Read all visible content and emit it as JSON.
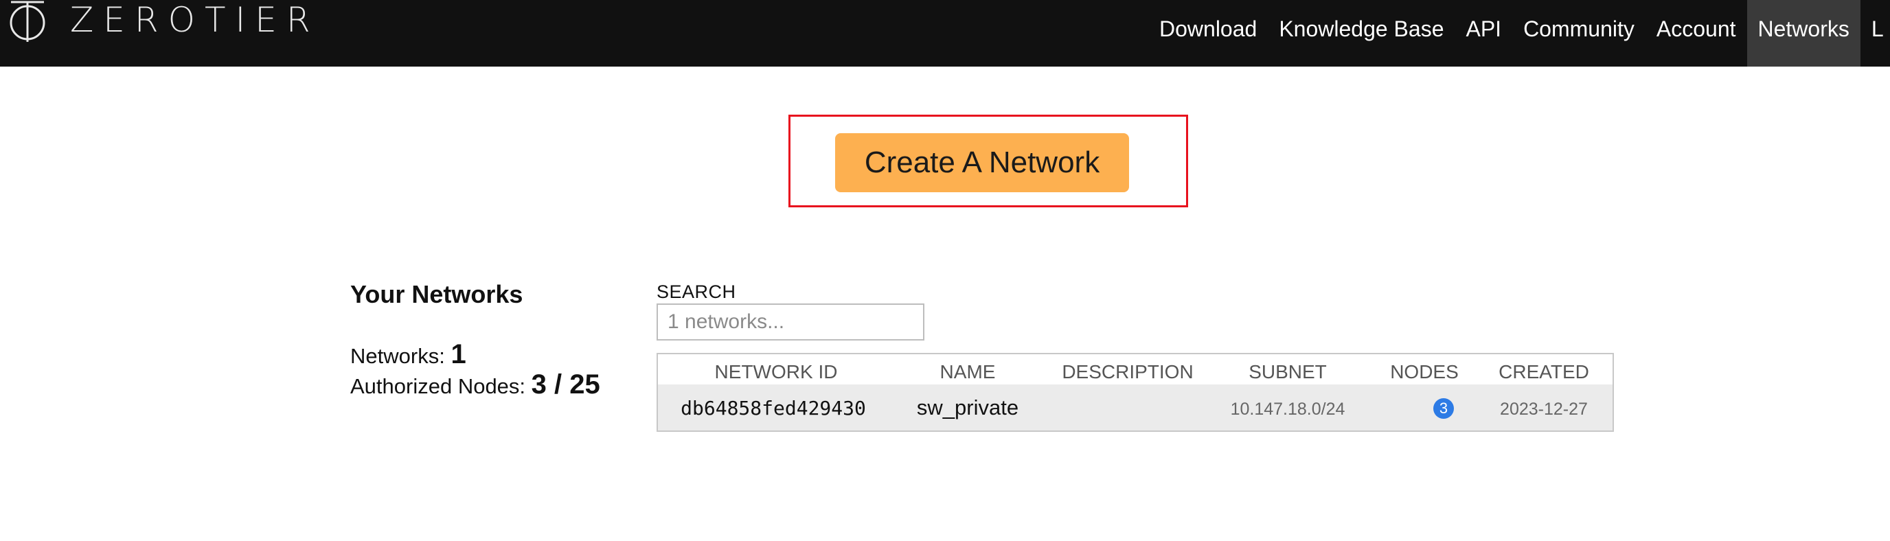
{
  "brand": {
    "logo_text": "ZEROTIER",
    "logo_icon": "zerotier-phi-logo"
  },
  "nav": {
    "items": [
      {
        "label": "Download"
      },
      {
        "label": "Knowledge Base"
      },
      {
        "label": "API"
      },
      {
        "label": "Community"
      },
      {
        "label": "Account"
      },
      {
        "label": "Networks",
        "active": true
      },
      {
        "label": "L"
      }
    ]
  },
  "actions": {
    "create_network_label": "Create A Network"
  },
  "summary": {
    "heading": "Your Networks",
    "networks_label": "Networks:",
    "networks_count": "1",
    "nodes_label": "Authorized Nodes:",
    "nodes_value": "3 / 25"
  },
  "search": {
    "label": "SEARCH",
    "placeholder": "1 networks..."
  },
  "table": {
    "columns": [
      "NETWORK ID",
      "NAME",
      "DESCRIPTION",
      "SUBNET",
      "NODES",
      "CREATED"
    ],
    "rows": [
      {
        "network_id": "db64858fed429430",
        "name": "sw_private",
        "description": "",
        "subnet": "10.147.18.0/24",
        "nodes": "3",
        "created": "2023-12-27"
      }
    ]
  },
  "colors": {
    "navbar_bg": "#111111",
    "nav_active_bg": "#3a3a3a",
    "create_button_bg": "#fdb050",
    "highlight_frame": "#e8121e",
    "node_badge": "#2d7be5",
    "row_bg": "#ebebeb"
  }
}
